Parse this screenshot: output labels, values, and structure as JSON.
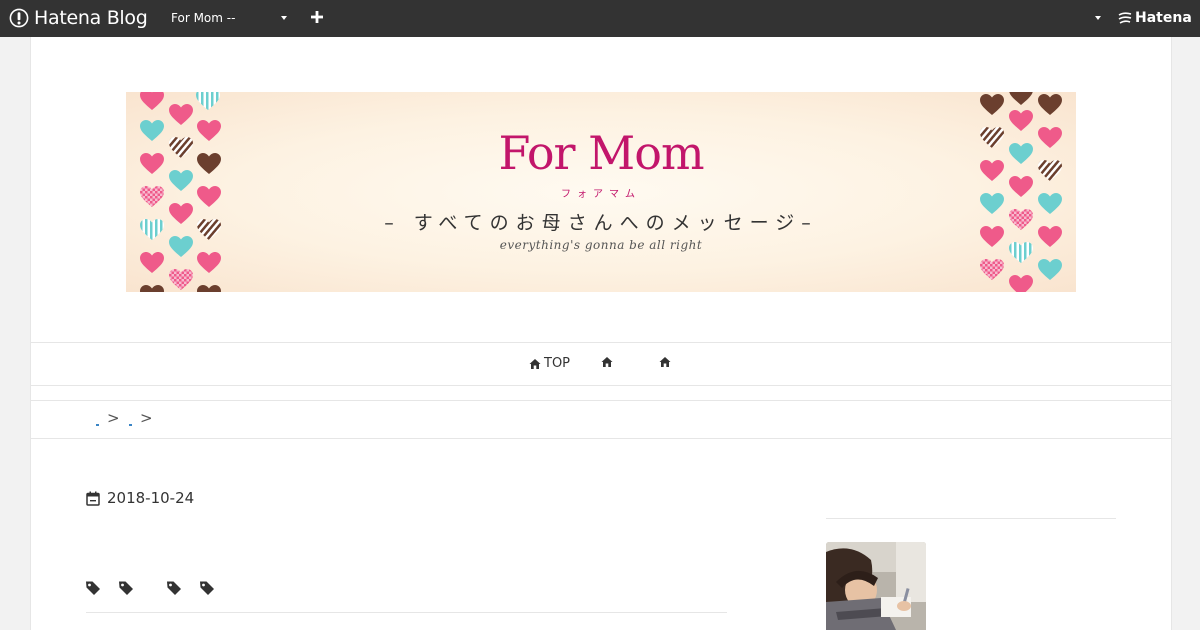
{
  "topbar": {
    "logo_text": "Hatena Blog",
    "blog_select": "For Mom --",
    "service_name": "Hatena",
    "icons": [
      "hatena-blog-logo-icon",
      "caret-down-icon",
      "plus-icon",
      "hatena-mark-icon"
    ]
  },
  "banner": {
    "title": "For Mom",
    "kana": "フォアマム",
    "subtitle": "– すべてのお母さんへのメッセージ–",
    "tagline": "everything's gonna be all right",
    "colors": {
      "title": "#c2166b",
      "pink_heart": "#ef5a8a",
      "teal_heart": "#6ccfcf",
      "brown_heart": "#6b3f2e"
    }
  },
  "nav": {
    "items": [
      {
        "label": "TOP",
        "icon": "home-icon"
      },
      {
        "label": "",
        "icon": "home-icon"
      },
      {
        "label": "",
        "icon": "home-icon"
      }
    ]
  },
  "breadcrumb": {
    "separators": [
      ">",
      ">"
    ]
  },
  "article": {
    "date": "2018-10-24",
    "date_icon": "calendar-icon",
    "tag_icon": "tag-icon",
    "tag_count": 4
  },
  "sidebar": {
    "profile_image": "child-writing-photo"
  }
}
